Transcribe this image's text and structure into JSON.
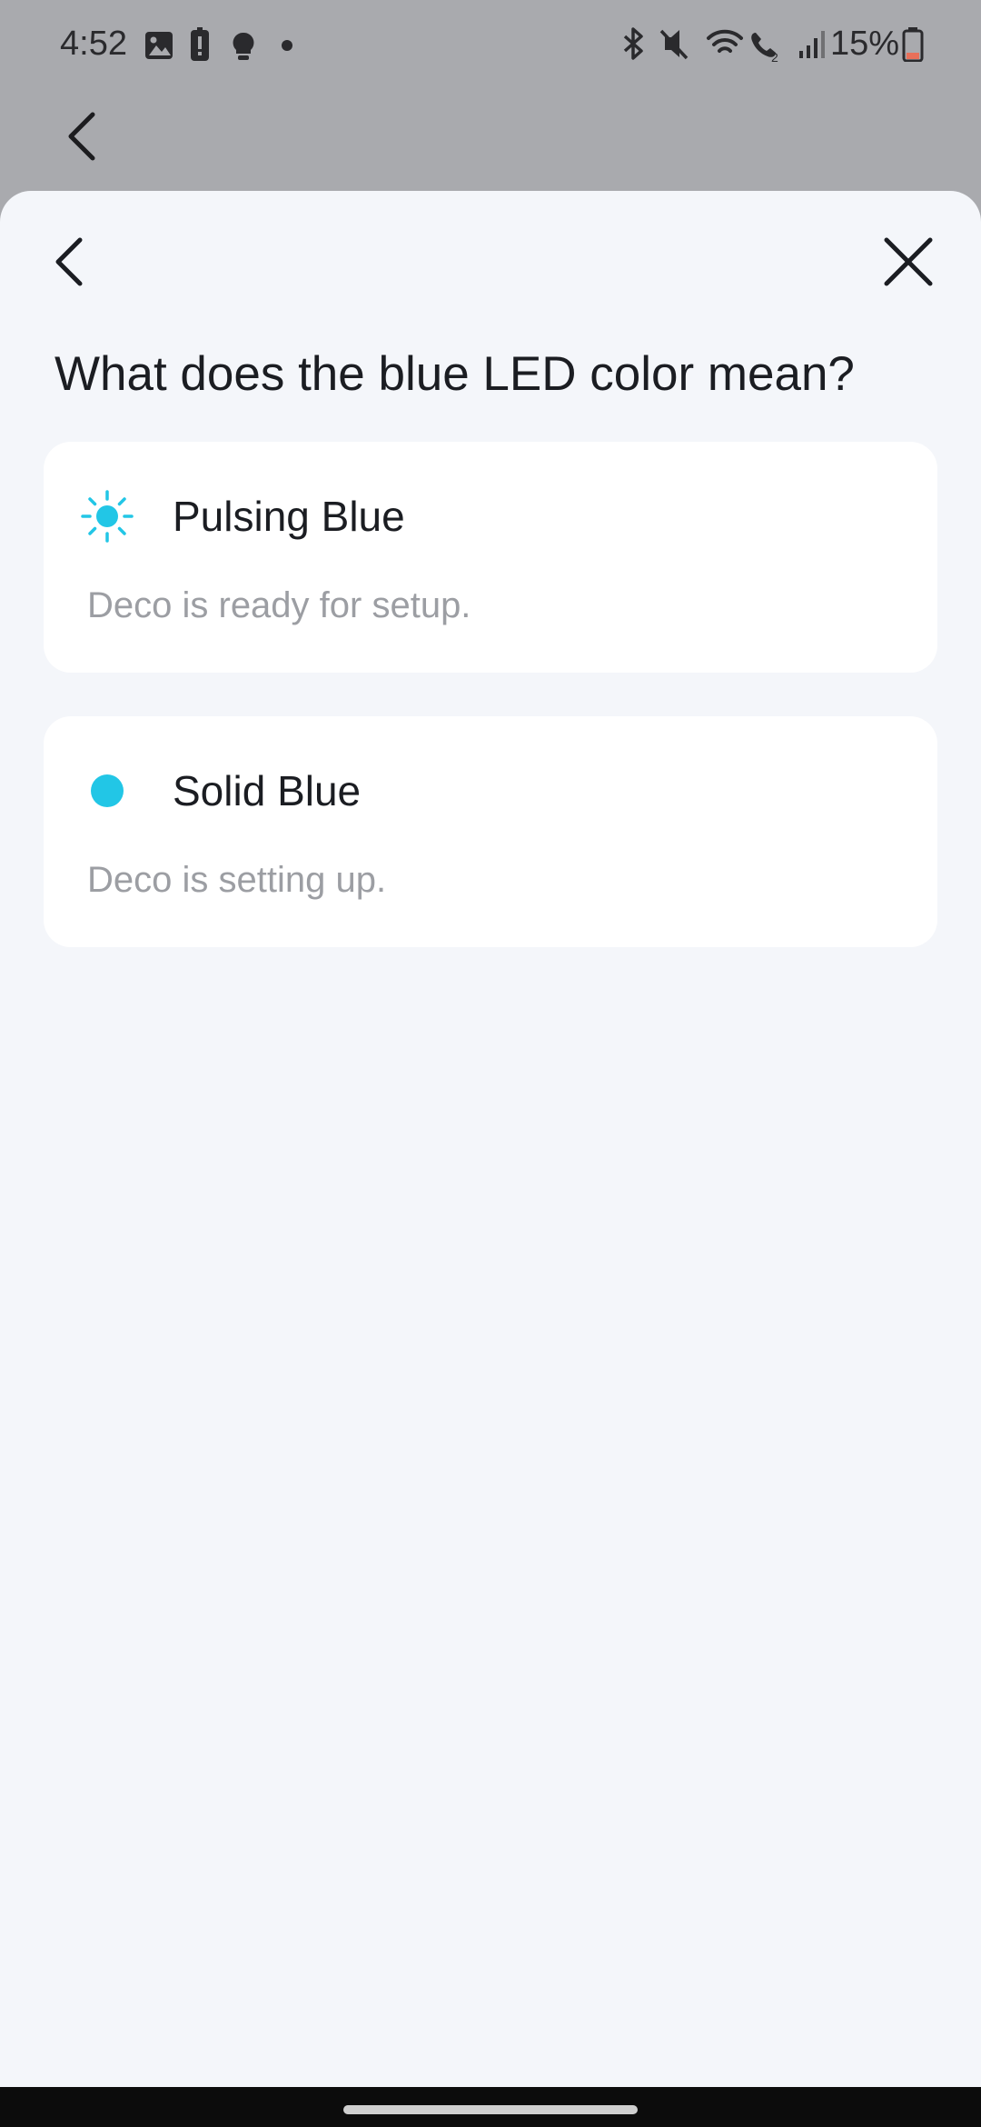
{
  "status_bar": {
    "time": "4:52",
    "battery": "15%",
    "left_icons": [
      "gallery-icon",
      "battery-alert-icon",
      "tips-bulb-icon",
      "dot-icon"
    ],
    "right_icons": [
      "bluetooth-icon",
      "mute-icon",
      "wifi-icon",
      "wifi-call-icon",
      "signal-icon",
      "battery-icon"
    ]
  },
  "sheet": {
    "title": "What does the blue LED color mean?",
    "led_states": [
      {
        "name": "Pulsing Blue",
        "description": "Deco is ready for setup.",
        "icon": "pulsing-led-icon"
      },
      {
        "name": "Solid Blue",
        "description": "Deco is setting up.",
        "icon": "solid-led-icon"
      }
    ]
  },
  "colors": {
    "led_blue": "#22c6e6",
    "sheet_bg": "#f4f6fa",
    "card_bg": "#ffffff",
    "title_text": "#1b1d22",
    "secondary_text": "#9c9ea3",
    "dimmed_backdrop": "#a9aaae"
  }
}
